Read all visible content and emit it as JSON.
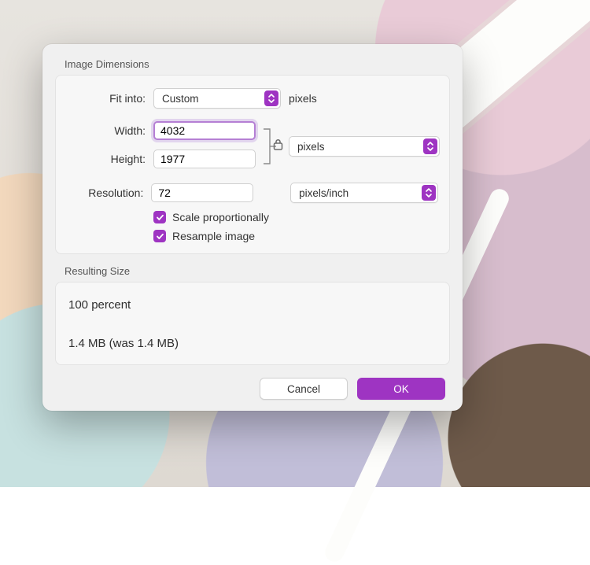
{
  "colors": {
    "accent": "#9e34c2",
    "focusRing": "#b57fd4"
  },
  "sections": {
    "dimensions_title": "Image Dimensions",
    "resulting_title": "Resulting Size"
  },
  "fit": {
    "label": "Fit into:",
    "value": "Custom",
    "unit_suffix": "pixels"
  },
  "width": {
    "label": "Width:",
    "value": "4032"
  },
  "height": {
    "label": "Height:",
    "value": "1977"
  },
  "link_lock": {
    "locked": true,
    "icon": "lock-icon"
  },
  "wh_units": {
    "value": "pixels"
  },
  "resolution": {
    "label": "Resolution:",
    "value": "72"
  },
  "resolution_units": {
    "value": "pixels/inch"
  },
  "checks": {
    "scale_label": "Scale proportionally",
    "scale_checked": true,
    "resample_label": "Resample image",
    "resample_checked": true
  },
  "result": {
    "percent_line": "100 percent",
    "size_line": "1.4 MB (was 1.4 MB)"
  },
  "footer": {
    "cancel": "Cancel",
    "ok": "OK"
  }
}
